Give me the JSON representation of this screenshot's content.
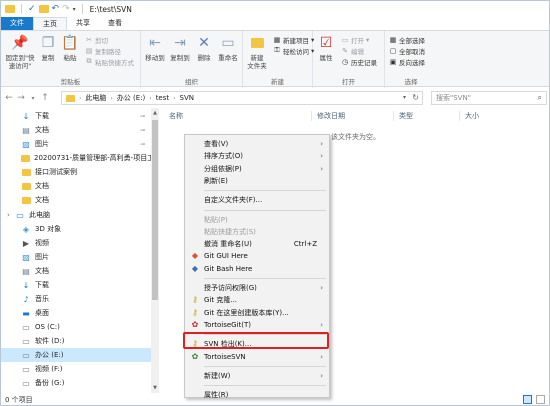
{
  "window": {
    "title": "E:\\test\\SVN"
  },
  "tabs": [
    "文件",
    "主页",
    "共享",
    "查看"
  ],
  "ribbon": {
    "clipboard": {
      "label": "剪贴板",
      "pin": "固定到\"快速访问\"",
      "copy": "复制",
      "paste": "粘贴",
      "cut": "剪切",
      "copy_path": "复制路径",
      "paste_shortcut": "粘贴快捷方式"
    },
    "organize": {
      "label": "组织",
      "move_to": "移动到",
      "copy_to": "复制到",
      "delete": "删除",
      "rename": "重命名"
    },
    "new": {
      "label": "新建",
      "new_folder": "新建\n文件夹",
      "new_item": "新建项目",
      "easy_access": "轻松访问"
    },
    "open": {
      "label": "打开",
      "properties": "属性",
      "open": "打开",
      "edit": "编辑",
      "history": "历史记录"
    },
    "select": {
      "label": "选择",
      "select_all": "全部选择",
      "select_none": "全部取消",
      "invert": "反向选择"
    }
  },
  "address": {
    "crumbs": [
      "此电脑",
      "办公 (E:)",
      "test",
      "SVN"
    ],
    "search_placeholder": "搜索\"SVN\""
  },
  "nav_items": [
    {
      "label": "下载",
      "icon": "download-icon",
      "pin": true
    },
    {
      "label": "文档",
      "icon": "document-icon",
      "pin": true
    },
    {
      "label": "图片",
      "icon": "picture-icon",
      "pin": true
    },
    {
      "label": "20200731-质量管理部-高利勇-项目工",
      "icon": "folder-icon",
      "pin": false
    },
    {
      "label": "接口测试案例",
      "icon": "folder-icon",
      "pin": false
    },
    {
      "label": "文档",
      "icon": "folder-icon",
      "pin": false
    },
    {
      "label": "文档",
      "icon": "folder-icon",
      "pin": false
    },
    {
      "label": "此电脑",
      "icon": "computer-icon",
      "pin": false
    },
    {
      "label": "3D 对象",
      "icon": "3d-object-icon",
      "pin": false
    },
    {
      "label": "视频",
      "icon": "video-icon",
      "pin": false
    },
    {
      "label": "图片",
      "icon": "picture-icon",
      "pin": false
    },
    {
      "label": "文档",
      "icon": "document-icon",
      "pin": false
    },
    {
      "label": "下载",
      "icon": "download-icon",
      "pin": false
    },
    {
      "label": "音乐",
      "icon": "music-icon",
      "pin": false
    },
    {
      "label": "桌面",
      "icon": "desktop-icon",
      "pin": false
    },
    {
      "label": "OS (C:)",
      "icon": "drive-icon",
      "pin": false
    },
    {
      "label": "软件 (D:)",
      "icon": "drive-icon",
      "pin": false
    },
    {
      "label": "办公 (E:)",
      "icon": "drive-icon",
      "pin": false,
      "selected": true
    },
    {
      "label": "视频 (F:)",
      "icon": "drive-icon",
      "pin": false
    },
    {
      "label": "备份 (G:)",
      "icon": "drive-icon",
      "pin": false
    }
  ],
  "columns": {
    "name": "名称",
    "date": "修改日期",
    "type": "类型",
    "size": "大小"
  },
  "empty_text": "该文件夹为空。",
  "status": "0 个项目",
  "context_menu": [
    {
      "label": "查看(V)",
      "submenu": true
    },
    {
      "label": "排序方式(O)",
      "submenu": true
    },
    {
      "label": "分组依据(P)",
      "submenu": true
    },
    {
      "label": "刷新(E)"
    },
    {
      "sep": true
    },
    {
      "label": "自定义文件夹(F)..."
    },
    {
      "sep": true
    },
    {
      "label": "粘贴(P)",
      "disabled": true
    },
    {
      "label": "粘贴快捷方式(S)",
      "disabled": true
    },
    {
      "label": "撤消 重命名(U)",
      "shortcut": "Ctrl+Z"
    },
    {
      "label": "Git GUI Here",
      "icon": "git-gui-icon"
    },
    {
      "label": "Git Bash Here",
      "icon": "git-bash-icon"
    },
    {
      "sep": true
    },
    {
      "label": "授予访问权限(G)",
      "submenu": true
    },
    {
      "label": "Git 克隆...",
      "icon": "git-clone-icon"
    },
    {
      "label": "Git 在这里创建版本库(Y)...",
      "icon": "git-init-icon"
    },
    {
      "label": "TortoiseGit(T)",
      "icon": "tortoisegit-icon",
      "submenu": true
    },
    {
      "sep": true
    },
    {
      "label": "SVN 检出(K)...",
      "icon": "svn-checkout-icon"
    },
    {
      "label": "TortoiseSVN",
      "icon": "tortoisesvn-icon",
      "submenu": true
    },
    {
      "sep": true
    },
    {
      "label": "新建(W)",
      "submenu": true
    },
    {
      "sep": true
    },
    {
      "label": "属性(R)"
    }
  ],
  "colors": {
    "file_tab": "#1979ca",
    "highlight": "#e02020",
    "selection": "#cce8ff"
  }
}
